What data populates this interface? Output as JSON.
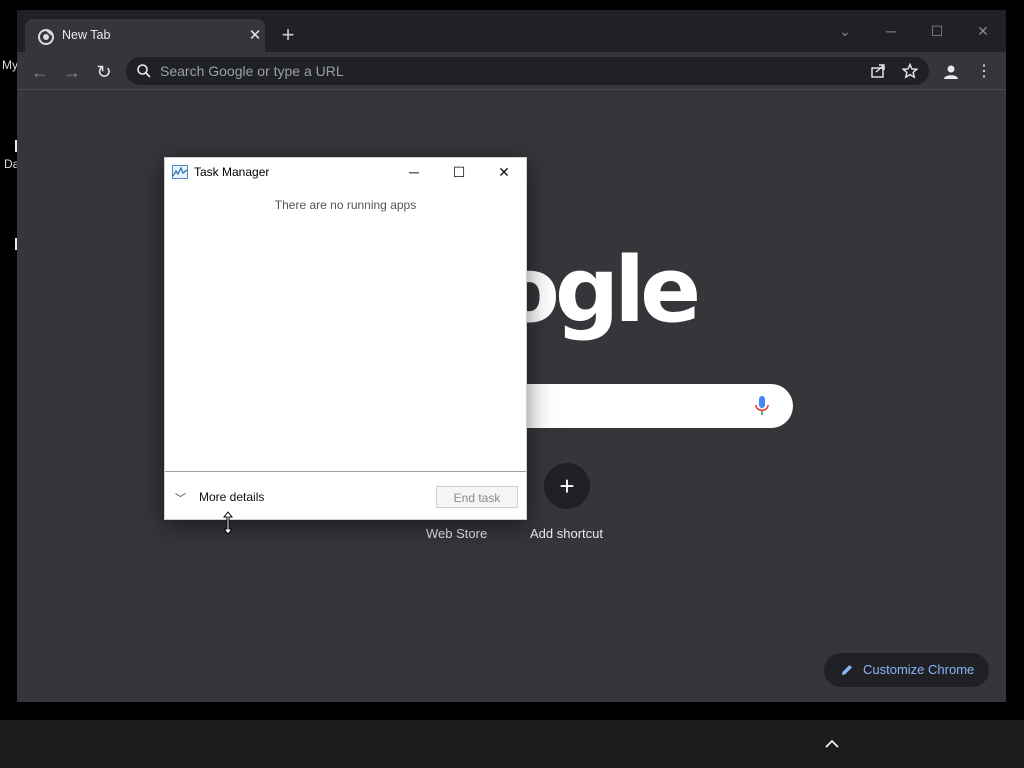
{
  "desktop": {
    "label_top": "My",
    "label_mid": "Da"
  },
  "browser": {
    "tab": {
      "title": "New Tab"
    },
    "omnibox": {
      "placeholder": "Search Google or type a URL"
    },
    "ntp": {
      "logo_fragment": "ogle",
      "shortcuts": [
        {
          "label": "Web Store"
        },
        {
          "label": "Add shortcut"
        }
      ],
      "customize_label": "Customize Chrome"
    },
    "colors": {
      "accent": "#8ab4f8",
      "frame": "#202124",
      "toolbar": "#35363a"
    }
  },
  "task_manager": {
    "title": "Task Manager",
    "empty_message": "There are no running apps",
    "more_details": "More details",
    "end_task": "End task"
  }
}
